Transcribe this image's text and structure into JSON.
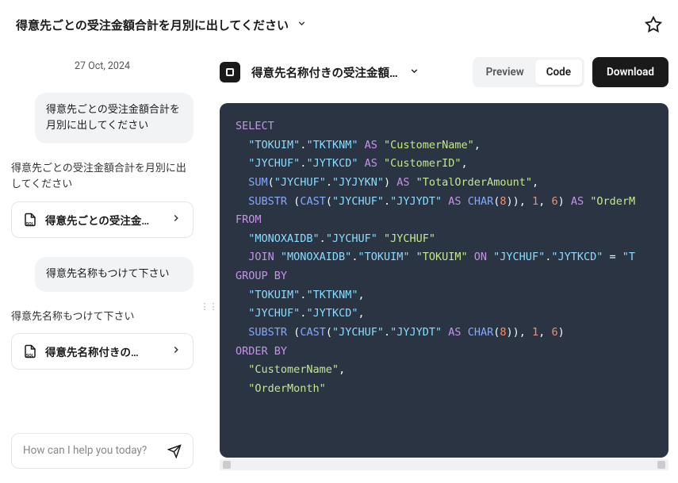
{
  "header": {
    "title": "得意先ごとの受注金額合計を月別に出してください"
  },
  "chat": {
    "date": "27 Oct, 2024",
    "messages": [
      {
        "type": "bubble",
        "text": "得意先ごとの受注金額合計を月別に出してください"
      },
      {
        "type": "section",
        "text": "得意先ごとの受注金額合計を月別に出してください"
      },
      {
        "type": "card",
        "label": "得意先ごとの受注金…"
      },
      {
        "type": "bubble",
        "text": "得意先名称もつけて下さい"
      },
      {
        "type": "section",
        "text": "得意先名称もつけて下さい"
      },
      {
        "type": "card",
        "label": "得意先名称付きの…"
      }
    ],
    "input_placeholder": "How can I help you today?"
  },
  "right": {
    "title": "得意先名称付きの受注金額…",
    "toggle": {
      "preview": "Preview",
      "code": "Code"
    },
    "download": "Download"
  },
  "code": {
    "l1a": "SELECT",
    "l2a": "\"TOKUIM\"",
    "l2b": ".",
    "l2c": "\"TKTKNM\"",
    "l2d": " AS ",
    "l2e": "\"CustomerName\"",
    "l2f": ",",
    "l3a": "\"JYCHUF\"",
    "l3b": ".",
    "l3c": "\"JYTKCD\"",
    "l3d": " AS ",
    "l3e": "\"CustomerID\"",
    "l3f": ",",
    "l4a": "SUM",
    "l4b": "(",
    "l4c": "\"JYCHUF\"",
    "l4d": ".",
    "l4e": "\"JYJYKN\"",
    "l4f": ")",
    "l4g": " AS ",
    "l4h": "\"TotalOrderAmount\"",
    "l4i": ",",
    "l5a": "SUBSTR ",
    "l5b": "(",
    "l5c": "CAST",
    "l5d": "(",
    "l5e": "\"JYCHUF\"",
    "l5f": ".",
    "l5g": "\"JYJYDT\"",
    "l5h": " AS ",
    "l5i": "CHAR",
    "l5j": "(",
    "l5k": "8",
    "l5l": ")",
    "l5m": ")",
    "l5n": ", ",
    "l5o": "1",
    "l5p": ", ",
    "l5q": "6",
    "l5r": ")",
    "l5s": " AS ",
    "l5t": "\"OrderM",
    "l6a": "FROM",
    "l7a": "\"MONOXAIDB\"",
    "l7b": ".",
    "l7c": "\"JYCHUF\"",
    "l7d": " ",
    "l7e": "\"JYCHUF\"",
    "l8a": "JOIN ",
    "l8b": "\"MONOXAIDB\"",
    "l8c": ".",
    "l8d": "\"TOKUIM\"",
    "l8e": " ",
    "l8f": "\"TOKUIM\"",
    "l8g": " ON ",
    "l8h": "\"JYCHUF\"",
    "l8i": ".",
    "l8j": "\"JYTKCD\"",
    "l8k": " = ",
    "l8l": "\"T",
    "l9a": "GROUP BY",
    "l10a": "\"TOKUIM\"",
    "l10b": ".",
    "l10c": "\"TKTKNM\"",
    "l10d": ",",
    "l11a": "\"JYCHUF\"",
    "l11b": ".",
    "l11c": "\"JYTKCD\"",
    "l11d": ",",
    "l12a": "SUBSTR ",
    "l12b": "(",
    "l12c": "CAST",
    "l12d": "(",
    "l12e": "\"JYCHUF\"",
    "l12f": ".",
    "l12g": "\"JYJYDT\"",
    "l12h": " AS ",
    "l12i": "CHAR",
    "l12j": "(",
    "l12k": "8",
    "l12l": ")",
    "l12m": ")",
    "l12n": ", ",
    "l12o": "1",
    "l12p": ", ",
    "l12q": "6",
    "l12r": ")",
    "l13a": "ORDER BY",
    "l14a": "\"CustomerName\"",
    "l14b": ",",
    "l15a": "\"OrderMonth\""
  }
}
